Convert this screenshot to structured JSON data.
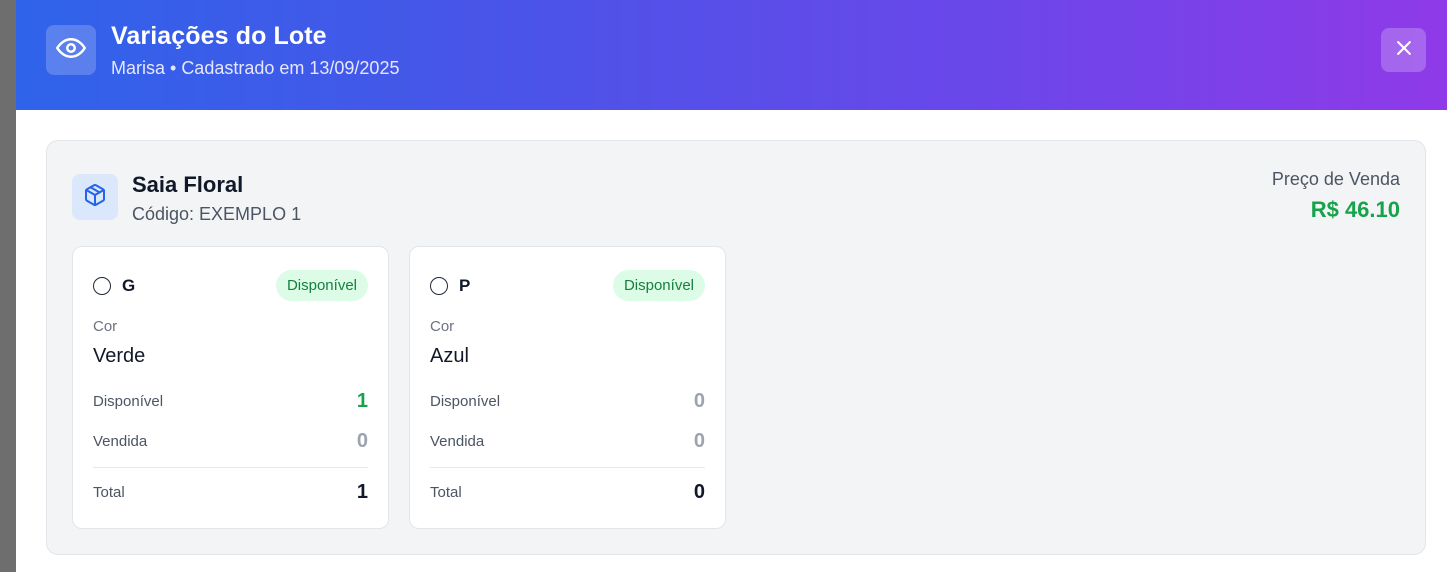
{
  "modal": {
    "title": "Variações do Lote",
    "subtitle": "Marisa • Cadastrado em 13/09/2025"
  },
  "product": {
    "name": "Saia Floral",
    "code": "Código: EXEMPLO 1",
    "price_label": "Preço de Venda",
    "price_value": "R$ 46.10"
  },
  "variants": [
    {
      "size": "G",
      "status": "Disponível",
      "color_label": "Cor",
      "color": "Verde",
      "available_label": "Disponível",
      "available": "1",
      "sold_label": "Vendida",
      "sold": "0",
      "total_label": "Total",
      "total": "1"
    },
    {
      "size": "P",
      "status": "Disponível",
      "color_label": "Cor",
      "color": "Azul",
      "available_label": "Disponível",
      "available": "0",
      "sold_label": "Vendida",
      "sold": "0",
      "total_label": "Total",
      "total": "0"
    }
  ],
  "colors": {
    "header_gradient_start": "#2f63ea",
    "header_gradient_end": "#8f3ae8",
    "price_green": "#16a34a",
    "badge_bg": "#dcfce7",
    "badge_text": "#15803d",
    "positive_value": "#16a34a",
    "zero_value": "#9ca3af",
    "total_value": "#111827"
  },
  "icons": {
    "header": "eye-icon",
    "close": "close-icon",
    "product": "package-icon"
  }
}
